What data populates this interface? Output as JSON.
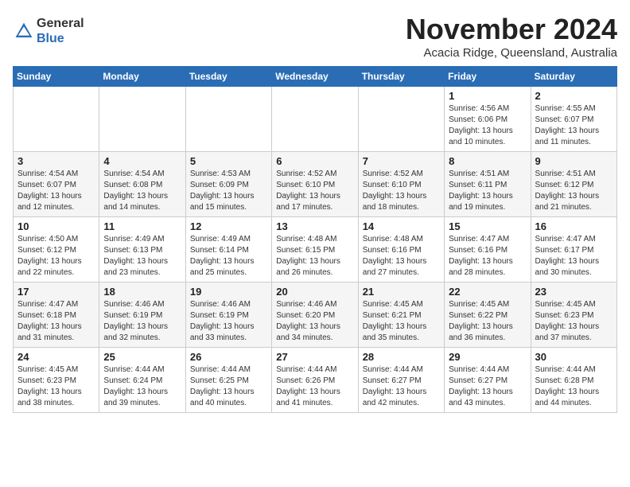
{
  "logo": {
    "general": "General",
    "blue": "Blue"
  },
  "title": "November 2024",
  "location": "Acacia Ridge, Queensland, Australia",
  "days_of_week": [
    "Sunday",
    "Monday",
    "Tuesday",
    "Wednesday",
    "Thursday",
    "Friday",
    "Saturday"
  ],
  "weeks": [
    [
      {
        "day": "",
        "info": ""
      },
      {
        "day": "",
        "info": ""
      },
      {
        "day": "",
        "info": ""
      },
      {
        "day": "",
        "info": ""
      },
      {
        "day": "",
        "info": ""
      },
      {
        "day": "1",
        "info": "Sunrise: 4:56 AM\nSunset: 6:06 PM\nDaylight: 13 hours\nand 10 minutes."
      },
      {
        "day": "2",
        "info": "Sunrise: 4:55 AM\nSunset: 6:07 PM\nDaylight: 13 hours\nand 11 minutes."
      }
    ],
    [
      {
        "day": "3",
        "info": "Sunrise: 4:54 AM\nSunset: 6:07 PM\nDaylight: 13 hours\nand 12 minutes."
      },
      {
        "day": "4",
        "info": "Sunrise: 4:54 AM\nSunset: 6:08 PM\nDaylight: 13 hours\nand 14 minutes."
      },
      {
        "day": "5",
        "info": "Sunrise: 4:53 AM\nSunset: 6:09 PM\nDaylight: 13 hours\nand 15 minutes."
      },
      {
        "day": "6",
        "info": "Sunrise: 4:52 AM\nSunset: 6:10 PM\nDaylight: 13 hours\nand 17 minutes."
      },
      {
        "day": "7",
        "info": "Sunrise: 4:52 AM\nSunset: 6:10 PM\nDaylight: 13 hours\nand 18 minutes."
      },
      {
        "day": "8",
        "info": "Sunrise: 4:51 AM\nSunset: 6:11 PM\nDaylight: 13 hours\nand 19 minutes."
      },
      {
        "day": "9",
        "info": "Sunrise: 4:51 AM\nSunset: 6:12 PM\nDaylight: 13 hours\nand 21 minutes."
      }
    ],
    [
      {
        "day": "10",
        "info": "Sunrise: 4:50 AM\nSunset: 6:12 PM\nDaylight: 13 hours\nand 22 minutes."
      },
      {
        "day": "11",
        "info": "Sunrise: 4:49 AM\nSunset: 6:13 PM\nDaylight: 13 hours\nand 23 minutes."
      },
      {
        "day": "12",
        "info": "Sunrise: 4:49 AM\nSunset: 6:14 PM\nDaylight: 13 hours\nand 25 minutes."
      },
      {
        "day": "13",
        "info": "Sunrise: 4:48 AM\nSunset: 6:15 PM\nDaylight: 13 hours\nand 26 minutes."
      },
      {
        "day": "14",
        "info": "Sunrise: 4:48 AM\nSunset: 6:16 PM\nDaylight: 13 hours\nand 27 minutes."
      },
      {
        "day": "15",
        "info": "Sunrise: 4:47 AM\nSunset: 6:16 PM\nDaylight: 13 hours\nand 28 minutes."
      },
      {
        "day": "16",
        "info": "Sunrise: 4:47 AM\nSunset: 6:17 PM\nDaylight: 13 hours\nand 30 minutes."
      }
    ],
    [
      {
        "day": "17",
        "info": "Sunrise: 4:47 AM\nSunset: 6:18 PM\nDaylight: 13 hours\nand 31 minutes."
      },
      {
        "day": "18",
        "info": "Sunrise: 4:46 AM\nSunset: 6:19 PM\nDaylight: 13 hours\nand 32 minutes."
      },
      {
        "day": "19",
        "info": "Sunrise: 4:46 AM\nSunset: 6:19 PM\nDaylight: 13 hours\nand 33 minutes."
      },
      {
        "day": "20",
        "info": "Sunrise: 4:46 AM\nSunset: 6:20 PM\nDaylight: 13 hours\nand 34 minutes."
      },
      {
        "day": "21",
        "info": "Sunrise: 4:45 AM\nSunset: 6:21 PM\nDaylight: 13 hours\nand 35 minutes."
      },
      {
        "day": "22",
        "info": "Sunrise: 4:45 AM\nSunset: 6:22 PM\nDaylight: 13 hours\nand 36 minutes."
      },
      {
        "day": "23",
        "info": "Sunrise: 4:45 AM\nSunset: 6:23 PM\nDaylight: 13 hours\nand 37 minutes."
      }
    ],
    [
      {
        "day": "24",
        "info": "Sunrise: 4:45 AM\nSunset: 6:23 PM\nDaylight: 13 hours\nand 38 minutes."
      },
      {
        "day": "25",
        "info": "Sunrise: 4:44 AM\nSunset: 6:24 PM\nDaylight: 13 hours\nand 39 minutes."
      },
      {
        "day": "26",
        "info": "Sunrise: 4:44 AM\nSunset: 6:25 PM\nDaylight: 13 hours\nand 40 minutes."
      },
      {
        "day": "27",
        "info": "Sunrise: 4:44 AM\nSunset: 6:26 PM\nDaylight: 13 hours\nand 41 minutes."
      },
      {
        "day": "28",
        "info": "Sunrise: 4:44 AM\nSunset: 6:27 PM\nDaylight: 13 hours\nand 42 minutes."
      },
      {
        "day": "29",
        "info": "Sunrise: 4:44 AM\nSunset: 6:27 PM\nDaylight: 13 hours\nand 43 minutes."
      },
      {
        "day": "30",
        "info": "Sunrise: 4:44 AM\nSunset: 6:28 PM\nDaylight: 13 hours\nand 44 minutes."
      }
    ]
  ]
}
